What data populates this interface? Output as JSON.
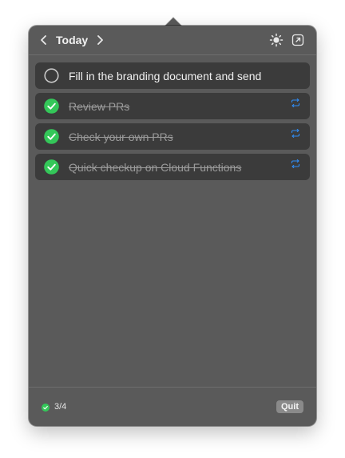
{
  "header": {
    "title": "Today",
    "prev_icon": "chevron-left-icon",
    "next_icon": "chevron-right-icon",
    "theme_icon": "sun-icon",
    "open_icon": "open-external-icon"
  },
  "tasks": [
    {
      "label": "Fill in the branding document and send",
      "completed": false,
      "repeating": false
    },
    {
      "label": "Review PRs",
      "completed": true,
      "repeating": true
    },
    {
      "label": "Check your own PRs",
      "completed": true,
      "repeating": true
    },
    {
      "label": "Quick checkup on Cloud Functions",
      "completed": true,
      "repeating": true
    }
  ],
  "footer": {
    "progress": "3/4",
    "quit_label": "Quit"
  },
  "colors": {
    "popover_bg": "#5a5a5a",
    "task_bg": "#3b3b3b",
    "check_green": "#34c759",
    "repeat_blue": "#2f8cf5",
    "quit_bg": "#8a8a8a"
  }
}
